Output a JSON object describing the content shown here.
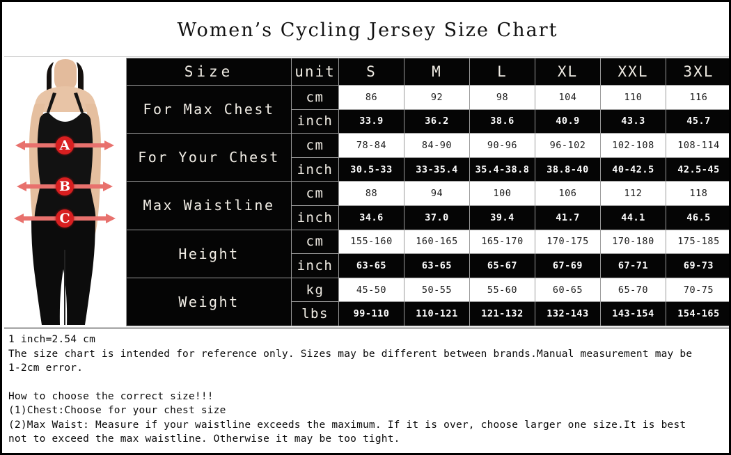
{
  "title": "Women’s Cycling Jersey Size Chart",
  "table": {
    "header": {
      "label": "Size",
      "unit": "unit",
      "sizes": [
        "S",
        "M",
        "L",
        "XL",
        "XXL",
        "3XL"
      ]
    },
    "rows": [
      {
        "label": "For Max Chest",
        "units": [
          "cm",
          "inch"
        ],
        "values_cm": [
          "86",
          "92",
          "98",
          "104",
          "110",
          "116"
        ],
        "values_inch": [
          "33.9",
          "36.2",
          "38.6",
          "40.9",
          "43.3",
          "45.7"
        ]
      },
      {
        "label": "For Your Chest",
        "units": [
          "cm",
          "inch"
        ],
        "values_cm": [
          "78-84",
          "84-90",
          "90-96",
          "96-102",
          "102-108",
          "108-114"
        ],
        "values_inch": [
          "30.5-33",
          "33-35.4",
          "35.4-38.8",
          "38.8-40",
          "40-42.5",
          "42.5-45"
        ]
      },
      {
        "label": "Max Waistline",
        "units": [
          "cm",
          "inch"
        ],
        "values_cm": [
          "88",
          "94",
          "100",
          "106",
          "112",
          "118"
        ],
        "values_inch": [
          "34.6",
          "37.0",
          "39.4",
          "41.7",
          "44.1",
          "46.5"
        ]
      },
      {
        "label": "Height",
        "units": [
          "cm",
          "inch"
        ],
        "values_cm": [
          "155-160",
          "160-165",
          "165-170",
          "170-175",
          "170-180",
          "175-185"
        ],
        "values_inch": [
          "63-65",
          "63-65",
          "65-67",
          "67-69",
          "67-71",
          "69-73"
        ]
      },
      {
        "label": "Weight",
        "units": [
          "kg",
          "lbs"
        ],
        "values_cm": [
          "45-50",
          "50-55",
          "55-60",
          "60-65",
          "65-70",
          "70-75"
        ],
        "values_inch": [
          "99-110",
          "110-121",
          "121-132",
          "132-143",
          "143-154",
          "154-165"
        ]
      }
    ]
  },
  "model": {
    "markers": [
      "A",
      "B",
      "C"
    ],
    "marker_color": "#d81f20",
    "arrow_color": "#e8716d"
  },
  "footer": {
    "line1": "1 inch=2.54 cm",
    "line2": "The size chart is intended for reference only. Sizes may be different between brands.Manual measurement may be",
    "line3": "1-2cm error.",
    "line4": "How to choose the correct size!!!",
    "line5": "(1)Chest:Choose for your chest size",
    "line6": "(2)Max Waist: Measure if your waistline exceeds the maximum. If it is over, choose larger one size.It is best",
    "line7": "not to exceed the max waistline. Otherwise it may be too tight."
  }
}
